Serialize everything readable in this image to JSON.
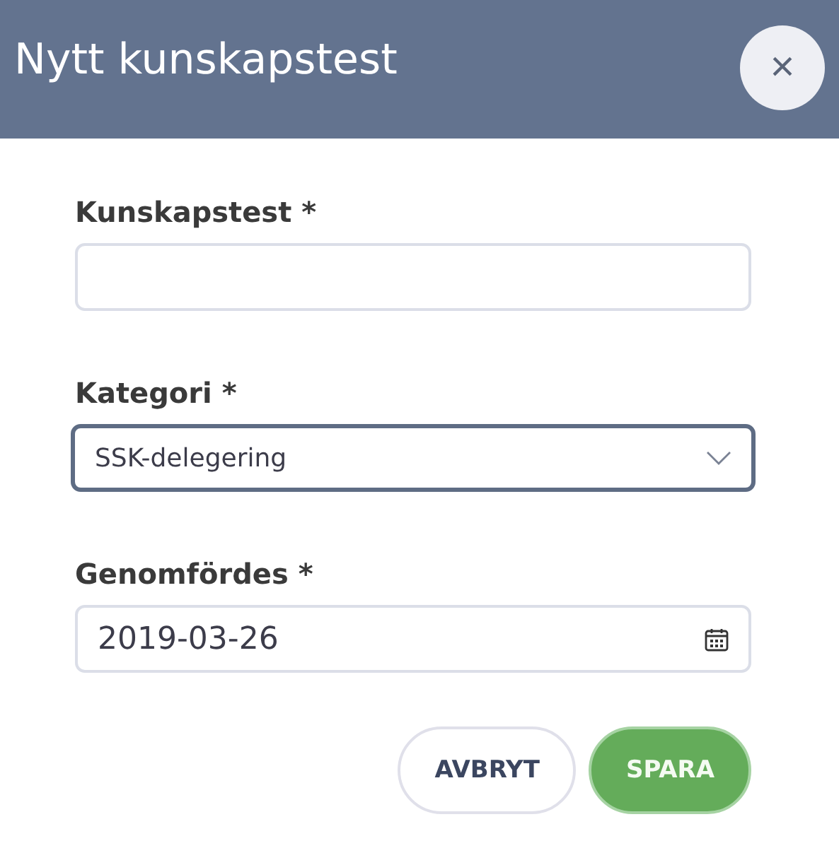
{
  "dialog": {
    "title": "Nytt kunskapstest",
    "close_icon": "×"
  },
  "fields": [
    {
      "kind": "text",
      "label": "Kunskapstest *",
      "focused": false
    },
    {
      "kind": "select",
      "label": "Kategori *",
      "value": "SSK-delegering",
      "focused": true
    },
    {
      "kind": "date",
      "label": "Genomfördes *",
      "value": "2019-03-26",
      "focused": false
    }
  ],
  "buttons": [
    {
      "kind": "secondary",
      "label": "AVBRYT"
    },
    {
      "kind": "primary",
      "label": "SPARA"
    }
  ]
}
